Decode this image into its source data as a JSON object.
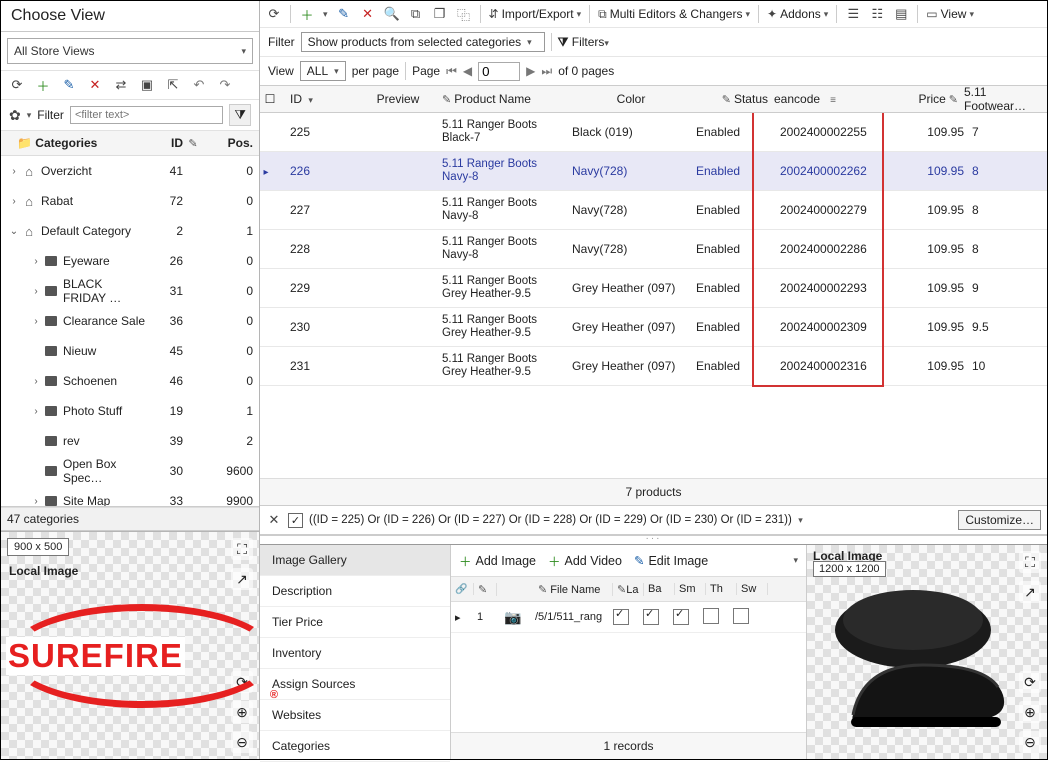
{
  "choose_view_title": "Choose View",
  "store_select": "All Store Views",
  "filter_label": "Filter",
  "filter_placeholder": "<filter text>",
  "categories_header": {
    "categories": "Categories",
    "id": "ID",
    "pos": "Pos."
  },
  "categories": [
    {
      "depth": 0,
      "expander": "›",
      "icon": "home",
      "label": "Overzicht",
      "id": "41",
      "pos": "0"
    },
    {
      "depth": 0,
      "expander": "›",
      "icon": "home",
      "label": "Rabat",
      "id": "72",
      "pos": "0"
    },
    {
      "depth": 0,
      "expander": "⌄",
      "icon": "home",
      "label": "Default Category",
      "id": "2",
      "pos": "1"
    },
    {
      "depth": 1,
      "expander": "›",
      "icon": "folder",
      "label": "Eyeware",
      "id": "26",
      "pos": "0"
    },
    {
      "depth": 1,
      "expander": "›",
      "icon": "folder",
      "label": "BLACK FRIDAY …",
      "id": "31",
      "pos": "0"
    },
    {
      "depth": 1,
      "expander": "›",
      "icon": "folder",
      "label": "Clearance Sale",
      "id": "36",
      "pos": "0"
    },
    {
      "depth": 1,
      "expander": "",
      "icon": "folder",
      "label": "Nieuw",
      "id": "45",
      "pos": "0"
    },
    {
      "depth": 1,
      "expander": "›",
      "icon": "folder",
      "label": "Schoenen",
      "id": "46",
      "pos": "0"
    },
    {
      "depth": 1,
      "expander": "›",
      "icon": "folder",
      "label": "Photo Stuff",
      "id": "19",
      "pos": "1"
    },
    {
      "depth": 1,
      "expander": "",
      "icon": "folder",
      "label": "rev",
      "id": "39",
      "pos": "2"
    },
    {
      "depth": 1,
      "expander": "",
      "icon": "folder",
      "label": "Open Box Spec…",
      "id": "30",
      "pos": "9600"
    },
    {
      "depth": 1,
      "expander": "›",
      "icon": "folder",
      "label": "Site Map",
      "id": "33",
      "pos": "9900"
    }
  ],
  "categories_summary": "47 categories",
  "img_left": {
    "badge": "900 x 500",
    "local_label": "Local Image",
    "brand": "SUREFIRE",
    "reg": "®"
  },
  "top_toolbar": {
    "import_export": "Import/Export",
    "multi_editors": "Multi Editors & Changers",
    "addons": "Addons",
    "view": "View"
  },
  "rp_filter": {
    "filter_label": "Filter",
    "filter_value": "Show products from selected categories",
    "filters_label": "Filters"
  },
  "rp_view": {
    "view_label": "View",
    "all": "ALL",
    "per_page": "per page",
    "page_label": "Page",
    "page_value": "0",
    "of_pages": "of 0 pages"
  },
  "grid_headers": {
    "id": "ID",
    "preview": "Preview",
    "product_name": "Product Name",
    "color": "Color",
    "status": "Status",
    "eancode": "eancode",
    "price": "Price",
    "footwear": "5.11 Footwear…"
  },
  "grid_rows": [
    {
      "id": "225",
      "name1": "5.11 Ranger Boots",
      "name2": "Black-7",
      "color": "Black (019)",
      "status": "Enabled",
      "ean": "2002400002255",
      "price": "109.95",
      "foot": "7",
      "selected": false
    },
    {
      "id": "226",
      "name1": "5.11 Ranger Boots",
      "name2": "Navy-8",
      "color": "Navy(728)",
      "status": "Enabled",
      "ean": "2002400002262",
      "price": "109.95",
      "foot": "8",
      "selected": true
    },
    {
      "id": "227",
      "name1": "5.11 Ranger Boots",
      "name2": "Navy-8",
      "color": "Navy(728)",
      "status": "Enabled",
      "ean": "2002400002279",
      "price": "109.95",
      "foot": "8",
      "selected": false
    },
    {
      "id": "228",
      "name1": "5.11 Ranger Boots",
      "name2": "Navy-8",
      "color": "Navy(728)",
      "status": "Enabled",
      "ean": "2002400002286",
      "price": "109.95",
      "foot": "8",
      "selected": false
    },
    {
      "id": "229",
      "name1": "5.11 Ranger Boots",
      "name2": "Grey Heather-9.5",
      "color": "Grey Heather (097)",
      "status": "Enabled",
      "ean": "2002400002293",
      "price": "109.95",
      "foot": "9",
      "selected": false
    },
    {
      "id": "230",
      "name1": "5.11 Ranger Boots",
      "name2": "Grey Heather-9.5",
      "color": "Grey Heather (097)",
      "status": "Enabled",
      "ean": "2002400002309",
      "price": "109.95",
      "foot": "9.5",
      "selected": false
    },
    {
      "id": "231",
      "name1": "5.11 Ranger Boots",
      "name2": "Grey Heather-9.5",
      "color": "Grey Heather (097)",
      "status": "Enabled",
      "ean": "2002400002316",
      "price": "109.95",
      "foot": "10",
      "selected": false
    }
  ],
  "grid_footer": "7 products",
  "filter_expr": "((ID = 225) Or (ID = 226) Or (ID = 227) Or (ID = 228) Or (ID = 229) Or (ID = 230) Or (ID = 231))",
  "customize_label": "Customize…",
  "tabs": [
    "Image Gallery",
    "Description",
    "Tier Price",
    "Inventory",
    "Assign Sources",
    "Websites",
    "Categories"
  ],
  "gallery": {
    "add_image": "Add Image",
    "add_video": "Add Video",
    "edit_image": "Edit Image",
    "cols": {
      "file": "File Name",
      "la": "La",
      "ba": "Ba",
      "sm": "Sm",
      "th": "Th",
      "sw": "Sw"
    },
    "row": {
      "num": "1",
      "file": "/5/1/511_rang",
      "checks": [
        true,
        true,
        true,
        false,
        false
      ]
    },
    "footer": "1 records"
  },
  "img_right": {
    "badge": "1200 x 1200",
    "local_label": "Local Image"
  }
}
